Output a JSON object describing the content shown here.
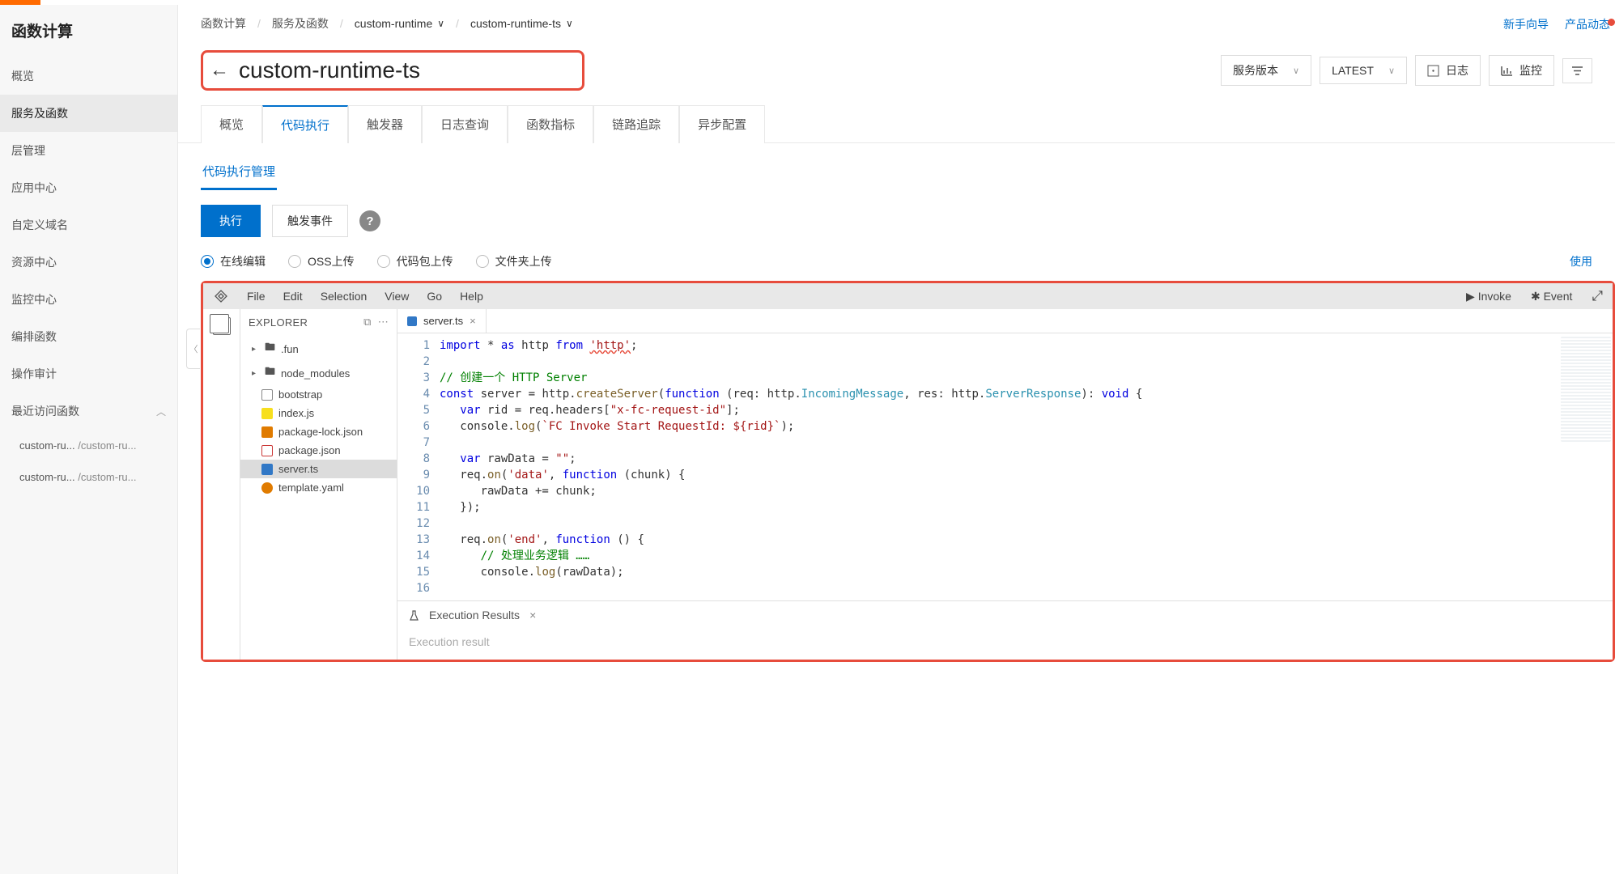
{
  "sidebar": {
    "title": "函数计算",
    "items": [
      {
        "label": "概览"
      },
      {
        "label": "服务及函数"
      },
      {
        "label": "层管理"
      },
      {
        "label": "应用中心"
      },
      {
        "label": "自定义域名"
      },
      {
        "label": "资源中心"
      },
      {
        "label": "监控中心"
      },
      {
        "label": "编排函数"
      },
      {
        "label": "操作审计"
      }
    ],
    "recent_header": "最近访问函数",
    "recent": [
      {
        "left": "custom-ru...",
        "right": "/custom-ru..."
      },
      {
        "left": "custom-ru...",
        "right": "/custom-ru..."
      }
    ]
  },
  "breadcrumb": {
    "items": [
      "函数计算",
      "服务及函数",
      "custom-runtime",
      "custom-runtime-ts"
    ]
  },
  "top_links": {
    "guide": "新手向导",
    "updates": "产品动态"
  },
  "header": {
    "title": "custom-runtime-ts",
    "version_label": "服务版本",
    "latest": "LATEST",
    "log": "日志",
    "monitor": "监控"
  },
  "tabs": [
    "概览",
    "代码执行",
    "触发器",
    "日志查询",
    "函数指标",
    "链路追踪",
    "异步配置"
  ],
  "subtab": "代码执行管理",
  "actions": {
    "run": "执行",
    "trigger": "触发事件"
  },
  "radios": [
    "在线编辑",
    "OSS上传",
    "代码包上传",
    "文件夹上传"
  ],
  "usage_link": "使用",
  "editor": {
    "menu": [
      "File",
      "Edit",
      "Selection",
      "View",
      "Go",
      "Help"
    ],
    "invoke": "Invoke",
    "event": "Event",
    "explorer": "EXPLORER",
    "tree": {
      "folders": [
        ".fun",
        "node_modules"
      ],
      "files": [
        {
          "name": "bootstrap",
          "icon": "file"
        },
        {
          "name": "index.js",
          "icon": "js"
        },
        {
          "name": "package-lock.json",
          "icon": "pkglock"
        },
        {
          "name": "package.json",
          "icon": "pkg"
        },
        {
          "name": "server.ts",
          "icon": "ts"
        },
        {
          "name": "template.yaml",
          "icon": "yaml"
        }
      ]
    },
    "open_tab": "server.ts",
    "exec_results": "Execution Results",
    "exec_result_label": "Execution result",
    "lines": {
      "l1a": "import",
      "l1b": "* ",
      "l1c": "as",
      "l1d": " http ",
      "l1e": "from",
      "l1f": "'http'",
      "l1g": ";",
      "l3": "// 创建一个 HTTP Server",
      "l4a": "const",
      "l4b": " server = http.",
      "l4c": "createServer",
      "l4d": "(",
      "l4e": "function",
      "l4f": " (req: http.",
      "l4g": "IncomingMessage",
      "l4h": ", res: http.",
      "l4i": "ServerResponse",
      "l4j": "): ",
      "l4k": "void",
      "l4l": " {",
      "l5a": "   var",
      "l5b": " rid = req.headers[",
      "l5c": "\"x-fc-request-id\"",
      "l5d": "];",
      "l6a": "   console.",
      "l6b": "log",
      "l6c": "(",
      "l6d": "`FC Invoke Start RequestId: ${rid}`",
      "l6e": ");",
      "l8a": "   var",
      "l8b": " rawData = ",
      "l8c": "\"\"",
      "l8d": ";",
      "l9a": "   req.",
      "l9b": "on",
      "l9c": "(",
      "l9d": "'data'",
      "l9e": ", ",
      "l9f": "function",
      "l9g": " (chunk) {",
      "l10": "      rawData += chunk;",
      "l11": "   });",
      "l13a": "   req.",
      "l13b": "on",
      "l13c": "(",
      "l13d": "'end'",
      "l13e": ", ",
      "l13f": "function",
      "l13g": " () {",
      "l14": "      // 处理业务逻辑 ……",
      "l15a": "      console.",
      "l15b": "log",
      "l15c": "(rawData);"
    }
  }
}
